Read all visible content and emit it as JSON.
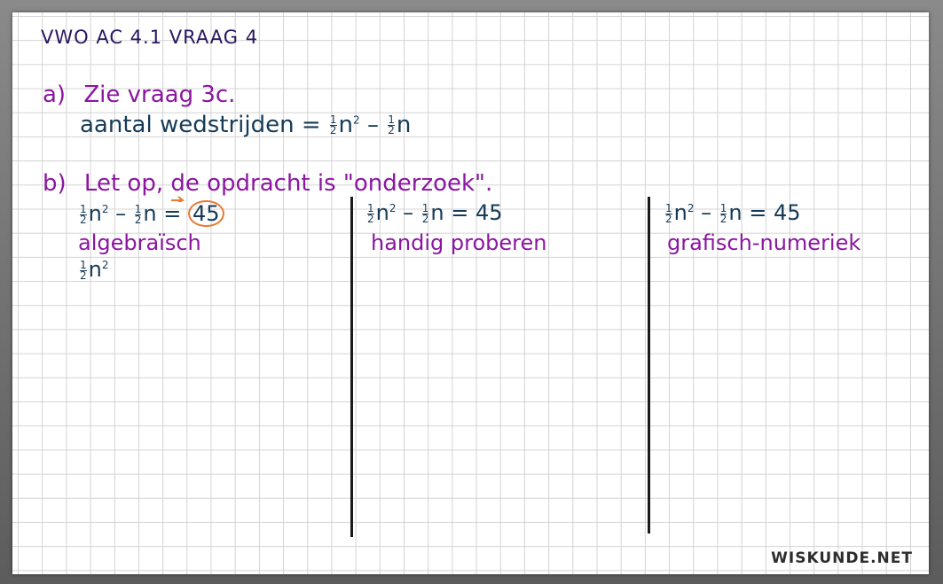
{
  "title": "VWO AC 4.1 VRAAG 4",
  "part_a": {
    "label": "a)",
    "line1": "Zie vraag 3c.",
    "line2_text": "aantal wedstrijden =",
    "formula": {
      "frac_num": "1",
      "frac_den": "2",
      "var": "n",
      "exp": "2",
      "minus": "–",
      "var2": "n"
    }
  },
  "part_b": {
    "label": "b)",
    "line1": "Let op, de opdracht is \"onderzoek\".",
    "columns": [
      {
        "eq_left": "n",
        "eq_exp": "2",
        "eq_minus": "–",
        "eq_mid": "n =",
        "eq_rhs": "45",
        "method": "algebraïsch",
        "extra": "n"
      },
      {
        "eq_left": "n",
        "eq_exp": "2",
        "eq_minus": "–",
        "eq_mid": "n =",
        "eq_rhs": "45",
        "method": "handig proberen"
      },
      {
        "eq_left": "n",
        "eq_exp": "2",
        "eq_minus": "–",
        "eq_mid": "n =",
        "eq_rhs": "45",
        "method": "grafisch-numeriek"
      }
    ],
    "frac_num": "1",
    "frac_den": "2"
  },
  "brand": "WISKUNDE.NET",
  "colors": {
    "purple": "#8b16a0",
    "teal": "#163b57",
    "orange": "#e87a33"
  }
}
